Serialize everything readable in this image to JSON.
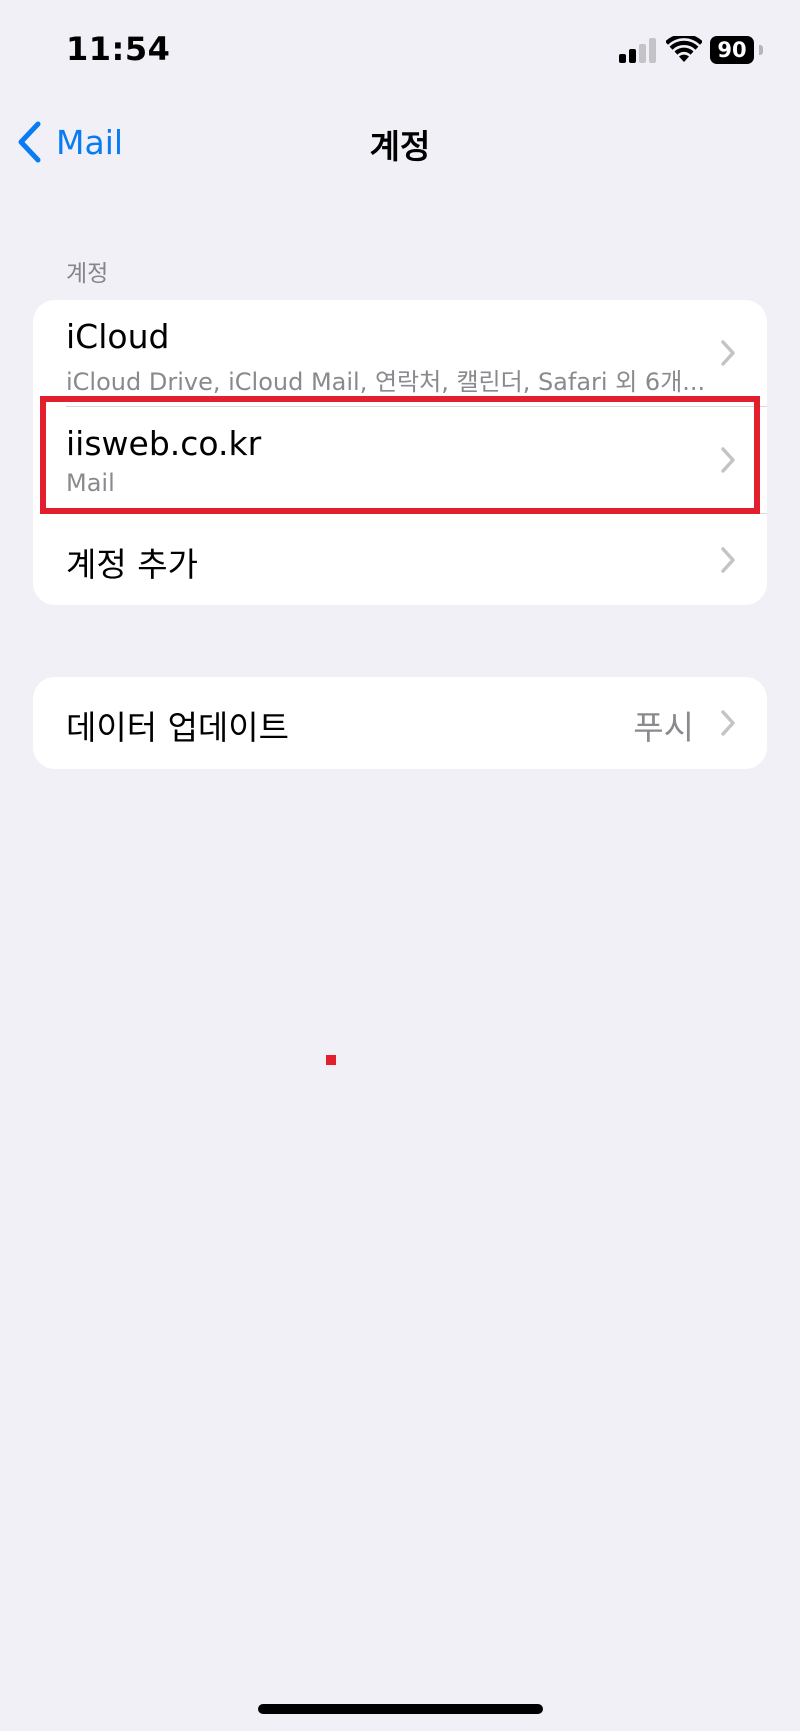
{
  "status_bar": {
    "time": "11:54",
    "battery_level": "90",
    "signal_bars_active": 2,
    "signal_bars_total": 4
  },
  "nav": {
    "back_label": "Mail",
    "title": "계정"
  },
  "accounts_section": {
    "header": "계정",
    "items": [
      {
        "title": "iCloud",
        "subtitle": "iCloud Drive, iCloud Mail, 연락처, 캘린더, Safari 외 6개..."
      },
      {
        "title": "iisweb.co.kr",
        "subtitle": "Mail"
      },
      {
        "title": "계정 추가"
      }
    ]
  },
  "data_section": {
    "fetch_label": "데이터 업데이트",
    "fetch_value": "푸시"
  },
  "colors": {
    "accent": "#0a7cf3",
    "background": "#f1f0f6",
    "highlight": "#e21f2c",
    "secondary_text": "#8a8a8e"
  }
}
